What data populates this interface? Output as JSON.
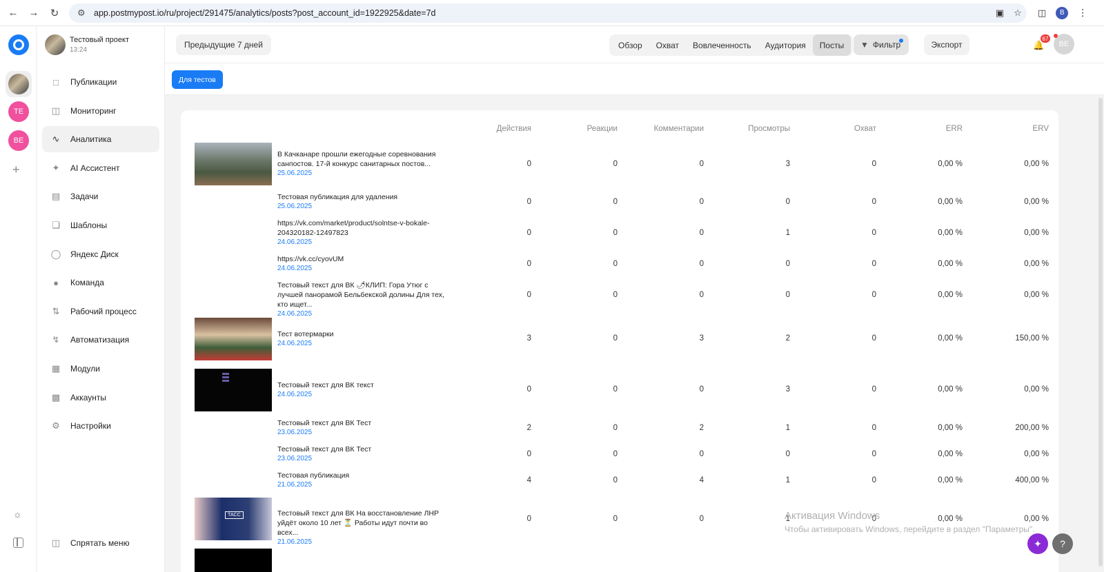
{
  "browser": {
    "url": "app.postmypost.io/ru/project/291475/analytics/posts?post_account_id=1922925&date=7d",
    "profile_initial": "B"
  },
  "rail": {
    "accounts": [
      "TE",
      "BE"
    ]
  },
  "sidebar": {
    "project_name": "Тестовый проект",
    "project_time": "13:24",
    "items": [
      {
        "label": "Публикации",
        "icon": "calendar-icon"
      },
      {
        "label": "Мониторинг",
        "icon": "monitoring-icon"
      },
      {
        "label": "Аналитика",
        "icon": "analytics-icon"
      },
      {
        "label": "AI Ассистент",
        "icon": "sparkle-icon"
      },
      {
        "label": "Задачи",
        "icon": "kanban-icon"
      },
      {
        "label": "Шаблоны",
        "icon": "templates-icon"
      },
      {
        "label": "Яндекс Диск",
        "icon": "disk-icon"
      },
      {
        "label": "Команда",
        "icon": "team-icon"
      },
      {
        "label": "Рабочий процесс",
        "icon": "workflow-icon"
      },
      {
        "label": "Автоматизация",
        "icon": "lightning-icon"
      },
      {
        "label": "Модули",
        "icon": "modules-icon"
      },
      {
        "label": "Аккаунты",
        "icon": "accounts-icon"
      },
      {
        "label": "Настройки",
        "icon": "gear-icon"
      }
    ],
    "hide_menu": "Спрятать меню"
  },
  "topbar": {
    "period": "Предыдущие 7 дней",
    "tabs": [
      "Обзор",
      "Охват",
      "Вовлеченность",
      "Аудитория",
      "Посты"
    ],
    "active_tab": "Посты",
    "filter": "Фильтр",
    "export": "Экспорт",
    "notifications_count": "67",
    "user_initials": "BE"
  },
  "subbar": {
    "tag": "Для тестов"
  },
  "table": {
    "columns": [
      "Действия",
      "Реакции",
      "Комментарии",
      "Просмотры",
      "Охват",
      "ERR",
      "ERV"
    ],
    "rows": [
      {
        "title": "В Качканаре прошли ежегодные соревнования санпостов. 17-й конкурс санитарных постов...",
        "date": "25.06.2025",
        "thumb": "photo-soldiers",
        "values": [
          "0",
          "0",
          "0",
          "3",
          "0",
          "0,00 %",
          "0,00 %"
        ]
      },
      {
        "title": "Тестовая публикация для удаления",
        "date": "25.06.2025",
        "thumb": "",
        "values": [
          "0",
          "0",
          "0",
          "0",
          "0",
          "0,00 %",
          "0,00 %"
        ]
      },
      {
        "title": "https://vk.com/market/product/solntse-v-bokale-204320182-12497823",
        "date": "24.06.2025",
        "thumb": "",
        "values": [
          "0",
          "0",
          "0",
          "1",
          "0",
          "0,00 %",
          "0,00 %"
        ]
      },
      {
        "title": "https://vk.cc/cyovUM",
        "date": "24.06.2025",
        "thumb": "",
        "values": [
          "0",
          "0",
          "0",
          "0",
          "0",
          "0,00 %",
          "0,00 %"
        ]
      },
      {
        "title": "Тестовый текст для ВК 🌶КЛИП: Гора Утюг с лучшей панорамой Бельбекской долины Для тех, кто ищет...",
        "date": "24.06.2025",
        "thumb": "",
        "values": [
          "0",
          "0",
          "0",
          "0",
          "0",
          "0,00 %",
          "0,00 %"
        ]
      },
      {
        "title": "Тест вотермарки",
        "date": "24.06.2025",
        "thumb": "photo-signing",
        "values": [
          "3",
          "0",
          "3",
          "2",
          "0",
          "0,00 %",
          "150,00 %"
        ]
      },
      {
        "title": "Тестовый текст для ВК текст",
        "date": "24.06.2025",
        "thumb": "photo-dark-screen",
        "values": [
          "0",
          "0",
          "0",
          "3",
          "0",
          "0,00 %",
          "0,00 %"
        ]
      },
      {
        "title": "Тестовый текст для ВК Тест",
        "date": "23.06.2025",
        "thumb": "",
        "values": [
          "2",
          "0",
          "2",
          "1",
          "0",
          "0,00 %",
          "200,00 %"
        ]
      },
      {
        "title": "Тестовый текст для ВК Тест",
        "date": "23.06.2025",
        "thumb": "",
        "values": [
          "0",
          "0",
          "0",
          "0",
          "0",
          "0,00 %",
          "0,00 %"
        ]
      },
      {
        "title": "Тестовая публикация",
        "date": "21.06.2025",
        "thumb": "",
        "values": [
          "4",
          "0",
          "4",
          "1",
          "0",
          "0,00 %",
          "400,00 %"
        ]
      },
      {
        "title": "Тестовый текст для ВК На восстановление ЛНР уйдёт около 10 лет ⏳ Работы идут почти во всех...",
        "date": "21.06.2025",
        "thumb": "photo-tass",
        "values": [
          "0",
          "0",
          "0",
          "1",
          "0",
          "0,00 %",
          "0,00 %"
        ]
      }
    ]
  },
  "overlay": {
    "watermark_title": "Активация Windows",
    "watermark_text": "Чтобы активировать Windows, перейдите в раздел \"Параметры\".",
    "help": "?",
    "tass_label": "ТАСС"
  },
  "colors": {
    "accent": "#1a7cf5",
    "date": "#1a7cf5",
    "avatar_pink": "#f0509d",
    "badge_red": "#f03e3e",
    "ai_fab": "#8a2bd6"
  }
}
